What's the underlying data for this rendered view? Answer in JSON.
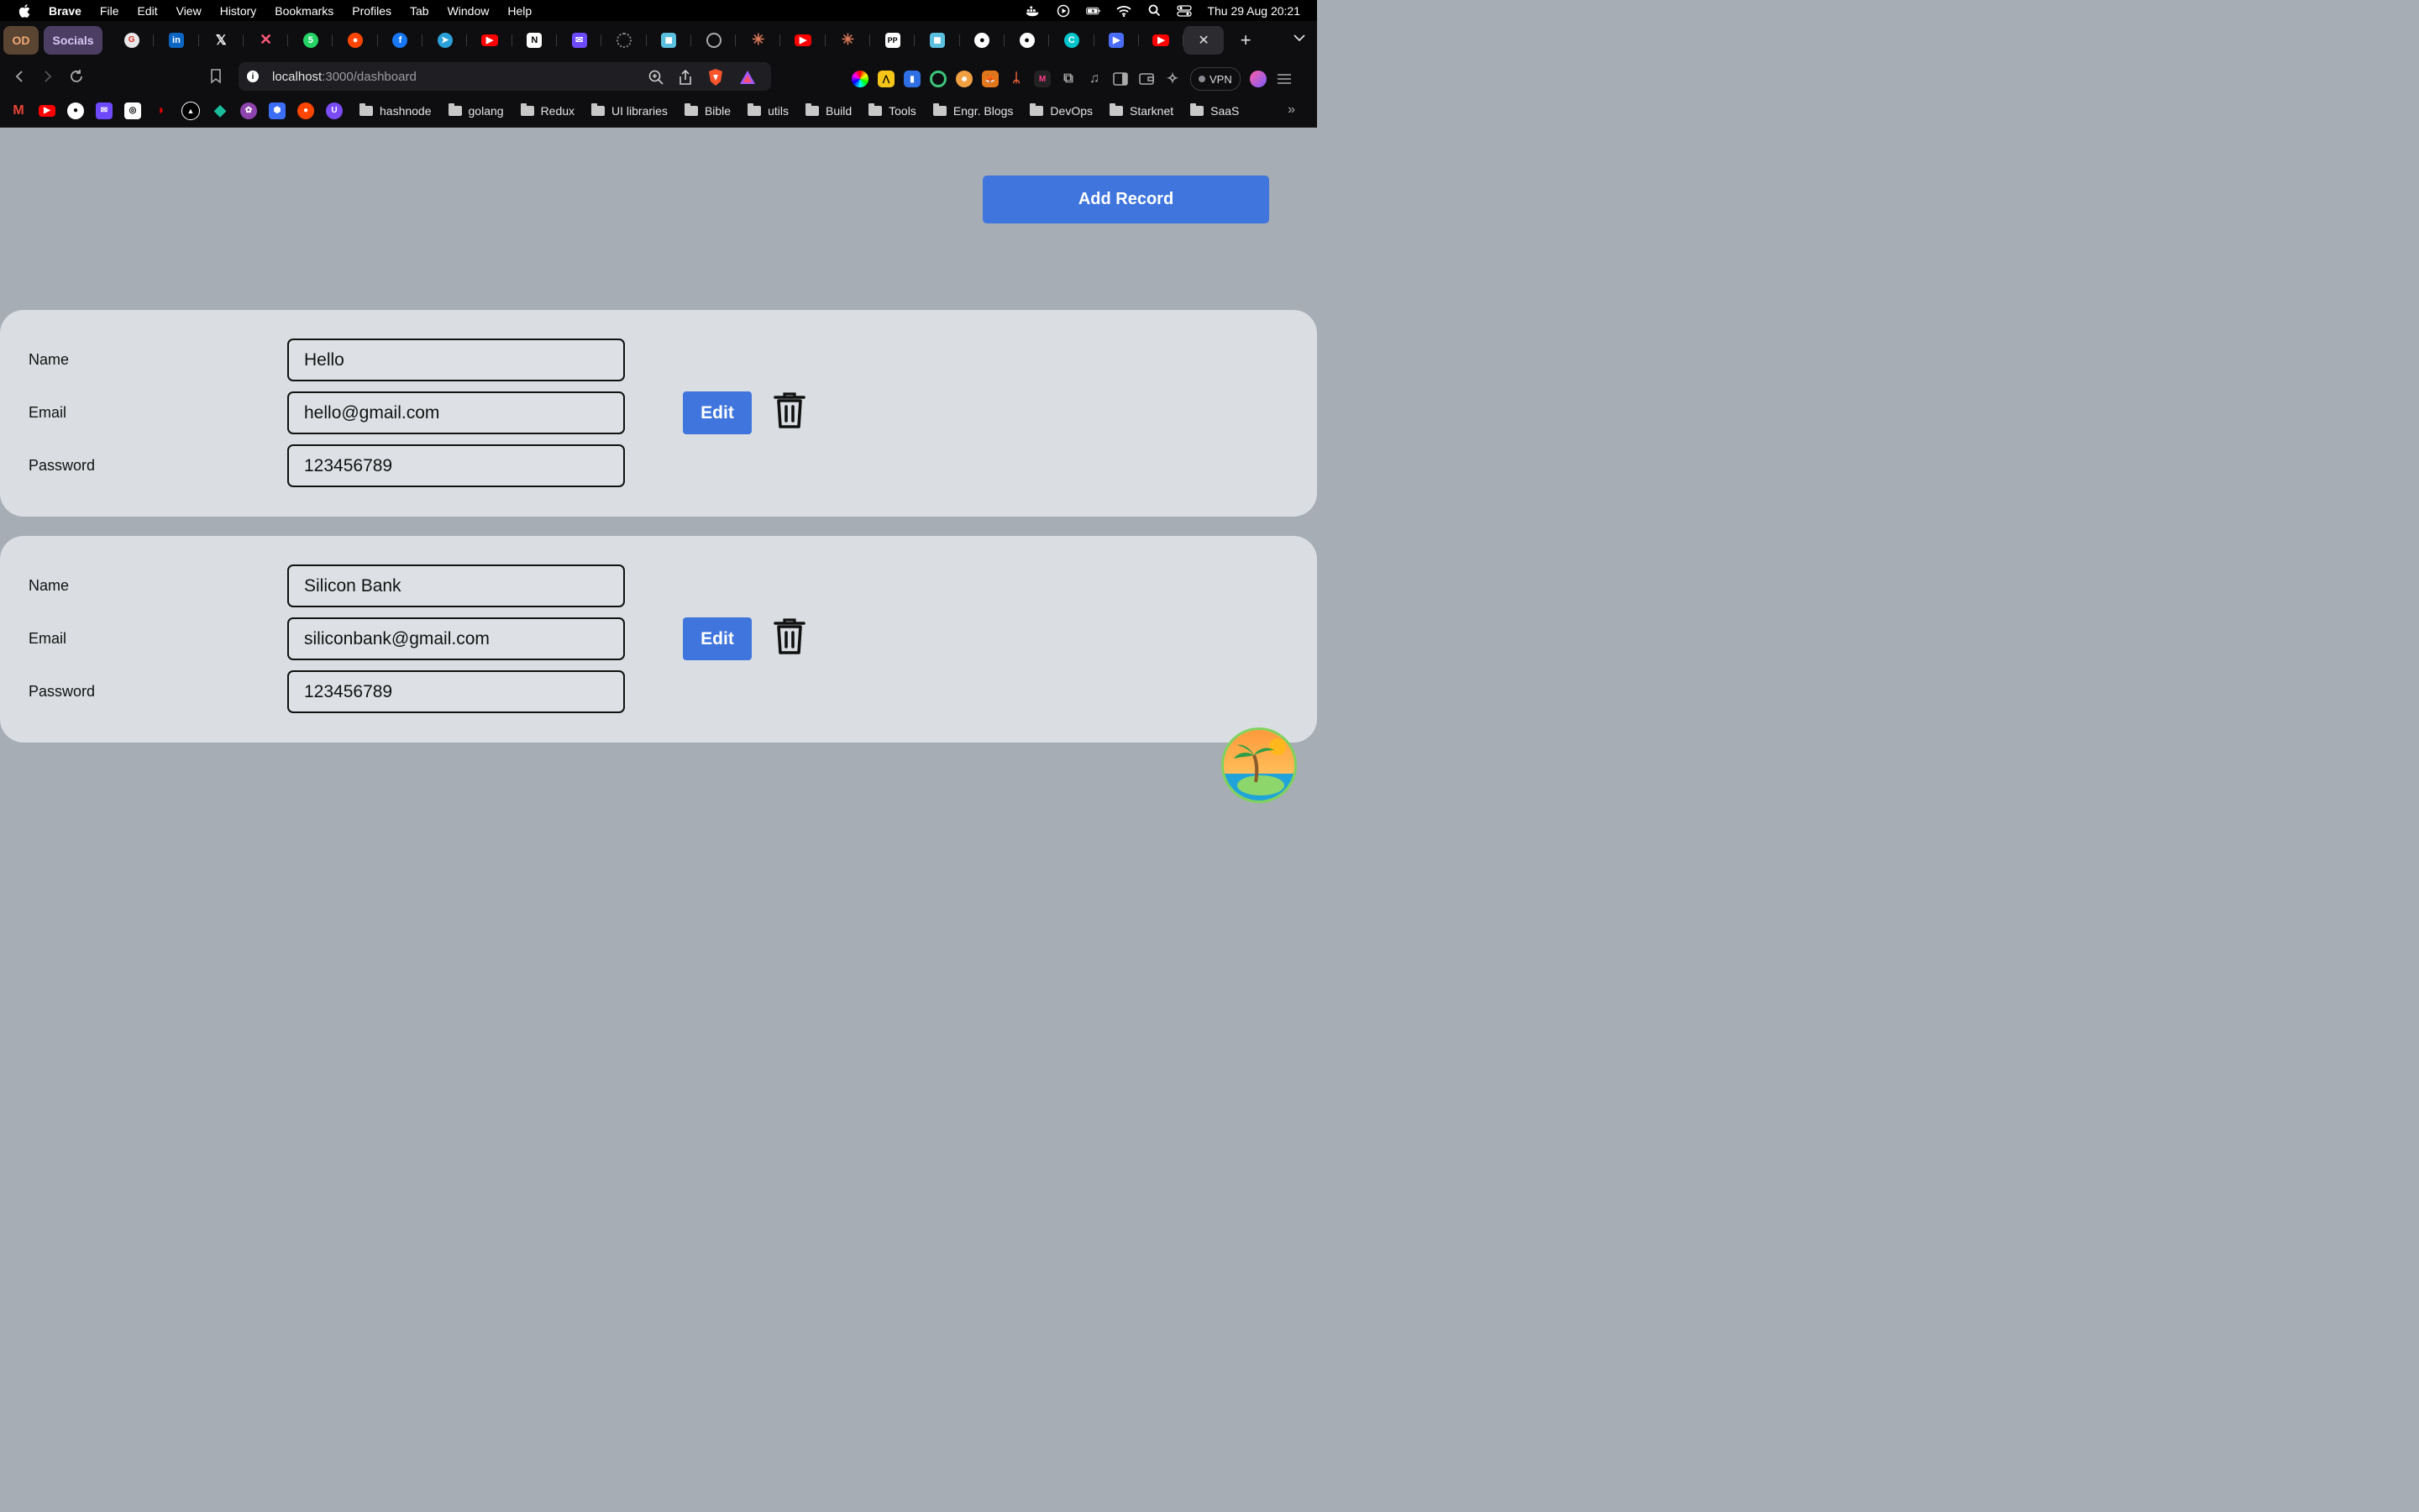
{
  "menubar": {
    "app": "Brave",
    "items": [
      "File",
      "Edit",
      "View",
      "History",
      "Bookmarks",
      "Profiles",
      "Tab",
      "Window",
      "Help"
    ],
    "clock": "Thu 29 Aug  20:21"
  },
  "tabs": {
    "profile_badge": "OD",
    "group_label": "Socials",
    "favicons": [
      "gmail-like",
      "linkedin",
      "x",
      "xcode-like",
      "whatsapp",
      "reddit",
      "facebook",
      "telegram",
      "youtube",
      "notion",
      "protonmail",
      "loading",
      "chatgpt-like",
      "circle",
      "claude",
      "youtube",
      "claude",
      "pp",
      "chatgpt-like",
      "github",
      "github",
      "canva",
      "zoom",
      "youtube"
    ],
    "active_close": "✕",
    "new_tab": "+"
  },
  "toolbar": {
    "url_host": "localhost",
    "url_path": ":3000/dashboard",
    "vpn_label": "VPN"
  },
  "bookmarks": {
    "folders": [
      "hashnode",
      "golang",
      "Redux",
      "UI libraries",
      "Bible",
      "utils",
      "Build",
      "Tools",
      "Engr. Blogs",
      "DevOps",
      "Starknet",
      "SaaS"
    ],
    "more": "»"
  },
  "page": {
    "add_record_label": "Add Record",
    "records": [
      {
        "name_label": "Name",
        "name_value": "Hello",
        "email_label": "Email",
        "email_value": "hello@gmail.com",
        "password_label": "Password",
        "password_value": "123456789",
        "edit_label": "Edit"
      },
      {
        "name_label": "Name",
        "name_value": "Silicon Bank",
        "email_label": "Email",
        "email_value": "siliconbank@gmail.com",
        "password_label": "Password",
        "password_value": "123456789",
        "edit_label": "Edit"
      }
    ]
  },
  "colors": {
    "accent": "#3f75dd",
    "page_bg": "#a7adb5",
    "card_bg": "#dadee2"
  }
}
